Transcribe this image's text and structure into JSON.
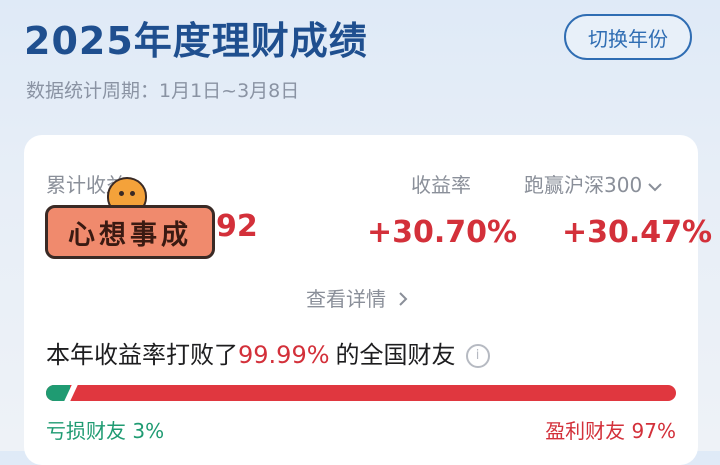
{
  "header": {
    "title": "2025年度理财成绩",
    "period": "数据统计周期：1月1日~3月8日",
    "switch_label": "切换年份"
  },
  "summary": {
    "cumulative_label": "累计收益",
    "cumulative_value_visible": "92",
    "sticker_text": "心想事成",
    "rate_label": "收益率",
    "rate_value": "+30.70%",
    "beat_index_label": "跑赢沪深300",
    "beat_index_value": "+30.47%",
    "detail_link": "查看详情",
    "icons": {
      "dropdown": "chevron-down-icon",
      "detail": "chevron-right-icon",
      "info": "info-icon"
    }
  },
  "ranking": {
    "prefix": "本年收益率打败了",
    "percent": "99.99%",
    "suffix": "的全国财友",
    "loss_label": "亏损财友 3%",
    "gain_label": "盈利财友 97%",
    "loss_fraction": 0.03,
    "colors": {
      "loss": "#1f9b72",
      "gain": "#e0373f",
      "accent": "#d3303a",
      "brand": "#1f4f8f"
    }
  }
}
